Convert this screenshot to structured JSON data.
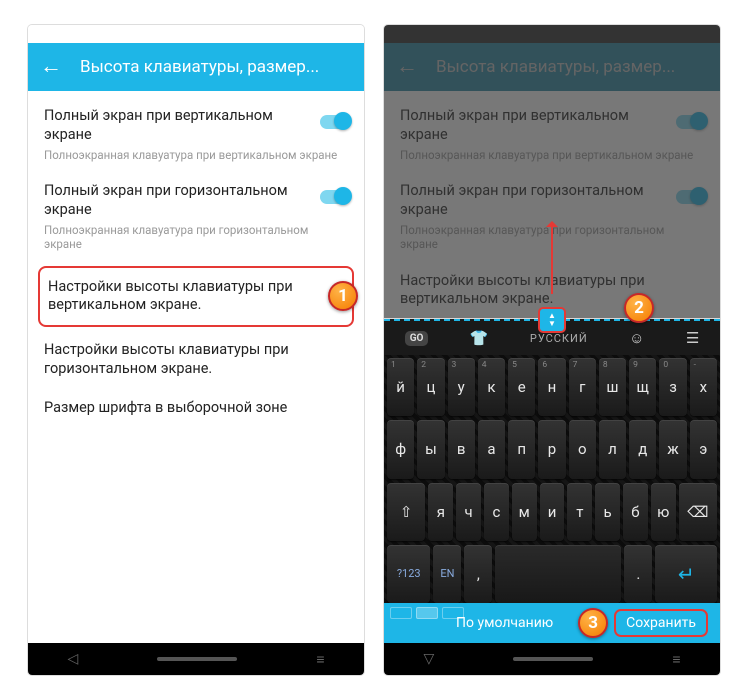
{
  "toolbar": {
    "title": "Высота клавиатуры, размер..."
  },
  "settings": {
    "item1_title": "Полный экран при вертикальном экране",
    "item1_sub": "Полноэкранная клавуатура при вертикальном экране",
    "item2_title": "Полный экран при горизонтальном экране",
    "item2_sub": "Полноэкранная клавуатура при горизонтальном экране",
    "item3_title": "Настройки высоты клавиатуры при вертикальном экране.",
    "item4_title": "Настройки высоты клавиатуры при горизонтальном экране.",
    "item5_title": "Размер шрифта в выборочной зоне"
  },
  "badges": {
    "b1": "1",
    "b2": "2",
    "b3": "3"
  },
  "keyboard": {
    "go": "GO",
    "lang": "РУССКИЙ",
    "row1_nums": [
      "1",
      "2",
      "3",
      "4",
      "5",
      "6",
      "7",
      "8",
      "9",
      "0",
      "-"
    ],
    "row1": [
      "й",
      "ц",
      "у",
      "к",
      "е",
      "н",
      "г",
      "ш",
      "щ",
      "з",
      "х"
    ],
    "row2": [
      "ф",
      "ы",
      "в",
      "а",
      "п",
      "р",
      "о",
      "л",
      "д",
      "ж",
      "э"
    ],
    "row3_shift": "⇧",
    "row3": [
      "я",
      "ч",
      "с",
      "м",
      "и",
      "т",
      "ь",
      "б",
      "ю"
    ],
    "row3_del": "⌫",
    "row4_sym": "?123",
    "row4_lang": "EN",
    "row4_comma": ",",
    "row4_dot": ".",
    "row4_enter": "↵",
    "default_btn": "По умолчанию",
    "save_btn": "Сохранить"
  }
}
